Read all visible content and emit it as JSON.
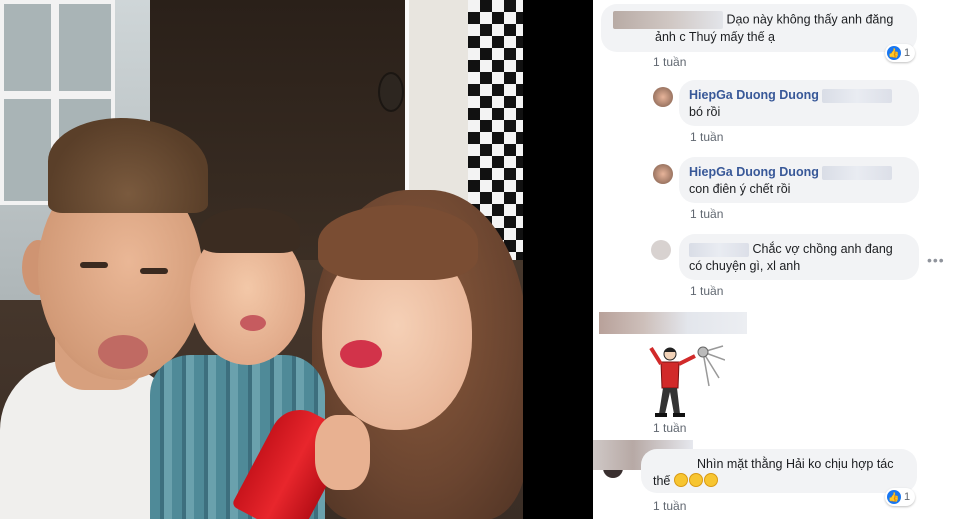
{
  "comments": [
    {
      "text": "Dạo này không thấy anh đăng ảnh c Thuý mấy thế ạ",
      "text_line1": "Dạo này không thấy anh đăng",
      "text_line2": "ảnh c Thuý mấy thế ạ",
      "time": "1 tuần",
      "likes": "1"
    },
    {
      "author": "HiepGa Duong Duong",
      "text": "bó rồi",
      "time": "1 tuần"
    },
    {
      "author": "HiepGa Duong Duong",
      "text": "con điên ý chết rồi",
      "time": "1 tuần"
    },
    {
      "text_line1": "Chắc vợ chồng anh đang",
      "text_line2": "có chuyện gì, xl anh",
      "time": "1 tuần"
    },
    {
      "sticker": "dancing-man-sticker",
      "time": "1 tuần"
    },
    {
      "text_line1": "Nhìn mặt thằng Hải ko chịu hợp tác",
      "text_line2": "thế",
      "emoji": [
        "rofl-emoji",
        "rofl-emoji",
        "rofl-emoji"
      ],
      "time": "1 tuần",
      "likes": "1"
    }
  ],
  "icons": {
    "like": "like-icon",
    "more": "more-options-icon"
  },
  "colors": {
    "author": "#385898",
    "bubble": "#f2f3f5",
    "like_blue": "#1877f2",
    "meta": "#606770"
  }
}
